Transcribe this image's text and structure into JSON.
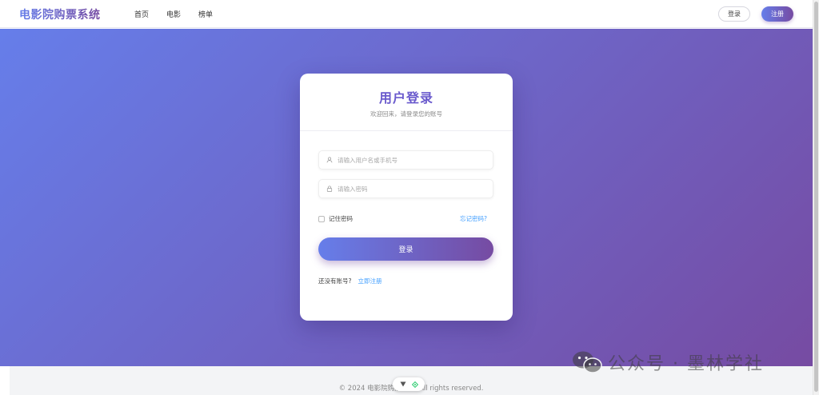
{
  "navbar": {
    "brand": "电影院购票系统",
    "items": [
      {
        "label": "首页"
      },
      {
        "label": "电影"
      },
      {
        "label": "榜单"
      }
    ],
    "login_label": "登录",
    "register_label": "注册"
  },
  "login_card": {
    "title": "用户登录",
    "subtitle": "欢迎回来，请登录您的账号",
    "username": {
      "value": "",
      "placeholder": "请输入用户名或手机号",
      "icon": "user-icon"
    },
    "password": {
      "value": "",
      "placeholder": "请输入密码",
      "icon": "lock-icon"
    },
    "remember_label": "记住密码",
    "forgot_label": "忘记密码?",
    "submit_label": "登录",
    "signup_question": "还没有账号?",
    "signup_link": "立即注册"
  },
  "footer": {
    "text": "© 2024 电影院购票系统. All rights reserved."
  },
  "floating_toolbar": {
    "icons": [
      "triangle-down-icon",
      "diamond-icon"
    ]
  },
  "watermark": {
    "text": "公众号 · 墨林学社",
    "icon": "wechat-icon"
  },
  "colors": {
    "gradient_start": "#667eea",
    "gradient_end": "#764ba2",
    "link": "#409eff",
    "title": "#6a5acd"
  }
}
